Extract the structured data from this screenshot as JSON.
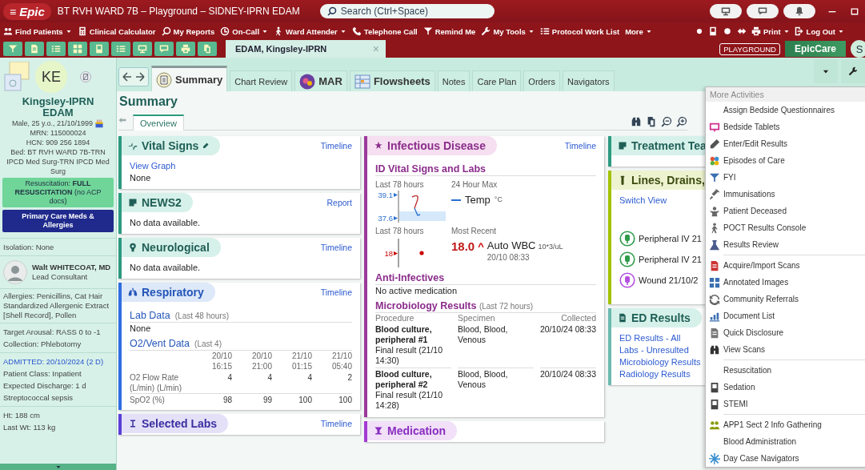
{
  "title_bar": {
    "menu_glyph": "≡",
    "logo": "Epic",
    "title": "BT RVH WARD 7B – Playground – SIDNEY-IPRN EDAM",
    "search": {
      "placeholder": "Search (Ctrl+Space)"
    }
  },
  "menu_bar": {
    "items": [
      {
        "label": "Find Patients",
        "dropdown": true
      },
      {
        "label": "Clinical Calculator",
        "dropdown": false
      },
      {
        "label": "My Reports",
        "dropdown": false
      },
      {
        "label": "On-Call",
        "dropdown": true
      },
      {
        "label": "Ward Attender",
        "dropdown": true
      },
      {
        "label": "Telephone Call",
        "dropdown": false
      },
      {
        "label": "Remind Me",
        "dropdown": false
      },
      {
        "label": "My Tools",
        "dropdown": true
      },
      {
        "label": "Protocol Work List",
        "dropdown": false
      },
      {
        "label": "More",
        "dropdown": true
      }
    ],
    "right_items": [
      {
        "label": "Print",
        "dropdown": true
      },
      {
        "label": "Log Out",
        "dropdown": true
      }
    ]
  },
  "patient_tab": {
    "label": "EDAM, Kingsley-IPRN",
    "close": "×"
  },
  "environment": {
    "badge": "PLAYGROUND",
    "product": "EpicCare",
    "user_initial": "S"
  },
  "patient": {
    "initials": "KE",
    "name": "Kingsley-IPRN EDAM",
    "demographics": "Male, 25 y.o., 21/10/1999",
    "mrn": "MRN: 115000024",
    "hcn": "HCN: 909 256 1894",
    "bed": "Bed: BT RVH WARD 7B-TRN IPCD Med Surg-TRN IPCD Med Surg",
    "resuscitation": "Resuscitation: **FULL RESUSCITATION** (no ACP docs)",
    "meds_button": "Primary Care Meds & Allergies",
    "isolation": "Isolation: None",
    "clinician": {
      "name": "Walt WHITECOAT, MD",
      "role": "Lead Consultant"
    },
    "allergies": "Allergies: Penicillins, Cat Hair Standardized Allergenic Extract [Shell Record], Pollen",
    "care_lines": [
      "Target Arousal: RASS 0 to -1",
      "Collection: Phlebotomy"
    ],
    "admitted": "ADMITTED: 20/10/2024 (2 D)",
    "admission_lines": [
      "Patient Class: Inpatient",
      "Expected Discharge: 1 d",
      "Streptococcal sepsis"
    ],
    "measure_lines": [
      "Ht: 188 cm",
      "Last Wt: 113 kg"
    ]
  },
  "activity_tabs": [
    {
      "label": "Summary",
      "selected": true
    },
    {
      "label": "Chart Review",
      "selected": false
    },
    {
      "label": "MAR",
      "selected": false
    },
    {
      "label": "Flowsheets",
      "selected": false
    },
    {
      "label": "Notes",
      "selected": false
    },
    {
      "label": "Care Plan",
      "selected": false
    },
    {
      "label": "Orders",
      "selected": false
    },
    {
      "label": "Navigators",
      "selected": false
    }
  ],
  "summary": {
    "title": "Summary",
    "subtabs": [
      {
        "label": "Overview",
        "selected": true
      }
    ]
  },
  "vital_signs": {
    "title": "Vital Signs",
    "link": "Timeline",
    "graph_link": "View Graph",
    "text": "None"
  },
  "news2": {
    "title": "NEWS2",
    "link": "Report",
    "text": "No data available."
  },
  "neurological": {
    "title": "Neurological",
    "link": "Timeline",
    "text": "No data available."
  },
  "respiratory": {
    "title": "Respiratory",
    "link": "Timeline",
    "lab_data": {
      "title": "Lab Data",
      "note": "(Last 48 hours)",
      "text": "None"
    },
    "vent_data": {
      "title": "O2/Vent Data",
      "note": "(Last 4)",
      "columns": [
        {
          "date": "20/10",
          "time": "16:15"
        },
        {
          "date": "20/10",
          "time": "21:00"
        },
        {
          "date": "21/10",
          "time": "01:15"
        },
        {
          "date": "21/10",
          "time": "05:40"
        }
      ],
      "rows": [
        {
          "label": "O2 Flow Rate (L/min) (L/min)",
          "values": [
            "4",
            "4",
            "4",
            "2"
          ]
        },
        {
          "label": "SpO2 (%)",
          "values": [
            "98",
            "99",
            "100",
            "100"
          ]
        }
      ]
    }
  },
  "selected_labs": {
    "title": "Selected Labs",
    "link": "Timeline"
  },
  "infectious_disease": {
    "title": "Infectious Disease",
    "link": "Timeline",
    "vitals_title": "ID Vital Signs and Labs",
    "temp": {
      "period": "Last 78 hours",
      "high": "39.1",
      "low": "37.6",
      "heading": "24 Hour Max",
      "label": "Temp",
      "unit": "°C"
    },
    "wbc": {
      "period": "Last 78 hours",
      "marker": "18",
      "heading": "Most Recent",
      "value": "18.0",
      "flag": "^",
      "label": "Auto WBC",
      "unit": "10*3/uL",
      "time": "20/10 08:33"
    },
    "anti_infectives": {
      "title": "Anti-Infectives",
      "text": "No active medication"
    },
    "microbiology": {
      "title": "Microbiology Results",
      "note": "(Last 72 hours)",
      "headers": [
        "Procedure",
        "Specimen",
        "Collected"
      ],
      "rows": [
        {
          "procedure": "Blood culture, peripheral #1",
          "status": "Final result (21/10 14:30)",
          "specimen": "Blood, Blood, Venous",
          "collected": "20/10/24 08:33"
        },
        {
          "procedure": "Blood culture, peripheral #2",
          "status": "Final result (21/10 14:28)",
          "specimen": "Blood, Blood, Venous",
          "collected": "20/10/24 08:33"
        }
      ]
    }
  },
  "medication": {
    "title": "Medication"
  },
  "treatment_team": {
    "title": "Treatment Tea"
  },
  "lines_drains": {
    "title": "Lines, Drains,",
    "link": "Switch View",
    "items": [
      {
        "label": "Peripheral IV 21",
        "color": "#2e9b4a"
      },
      {
        "label": "Peripheral IV 21",
        "color": "#2e9b4a"
      },
      {
        "label": "Wound 21/10/2",
        "color": "#b44fe0"
      }
    ]
  },
  "ed_results": {
    "title": "ED Results",
    "links": [
      "ED Results - All",
      "Labs - Unresulted",
      "Microbiology Results",
      "Radiology Results"
    ]
  },
  "more_activities": {
    "title": "More Activities",
    "groups": [
      [
        "Assign Bedside Questionnaires",
        "Bedside Tablets",
        "Enter/Edit Results",
        "Episodes of Care",
        "FYI",
        "Immunisations",
        "Patient Deceased",
        "POCT Results Console",
        "Results Review"
      ],
      [
        "Acquire/Import Scans",
        "Annotated Images",
        "Community Referrals",
        "Document List",
        "Quick Disclosure",
        "View Scans"
      ],
      [
        "Resuscitation",
        "Sedation",
        "STEMI"
      ],
      [
        "APP1 Sect 2 Info Gathering",
        "Blood Administration",
        "Day Case Navigators"
      ]
    ]
  }
}
